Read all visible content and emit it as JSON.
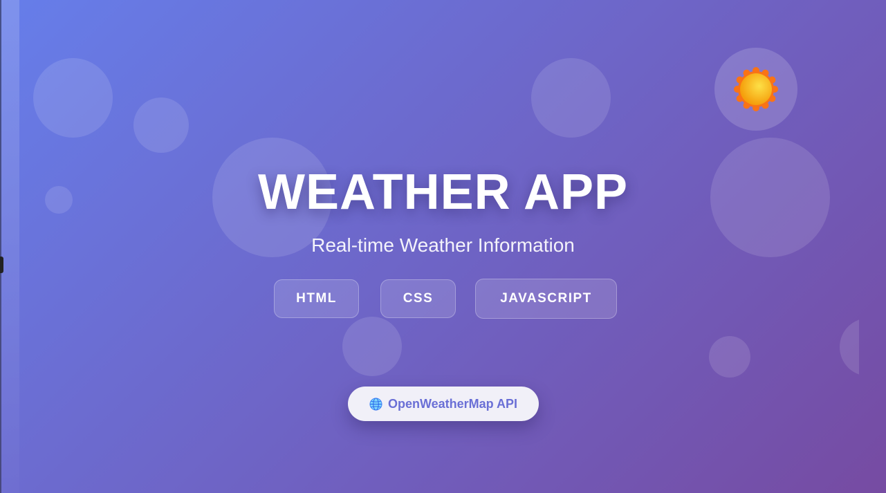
{
  "title": "WEATHER APP",
  "subtitle": "Real-time Weather Information",
  "tech_tags": [
    "HTML",
    "CSS",
    "JAVASCRIPT"
  ],
  "api_button": {
    "icon": "globe-icon",
    "label": "OpenWeatherMap API"
  },
  "weather_icon": "sun-icon",
  "colors": {
    "background_start": "#667eea",
    "background_end": "#764ba2",
    "button_text": "#6a6fd6",
    "sun": "#fbbf24"
  }
}
